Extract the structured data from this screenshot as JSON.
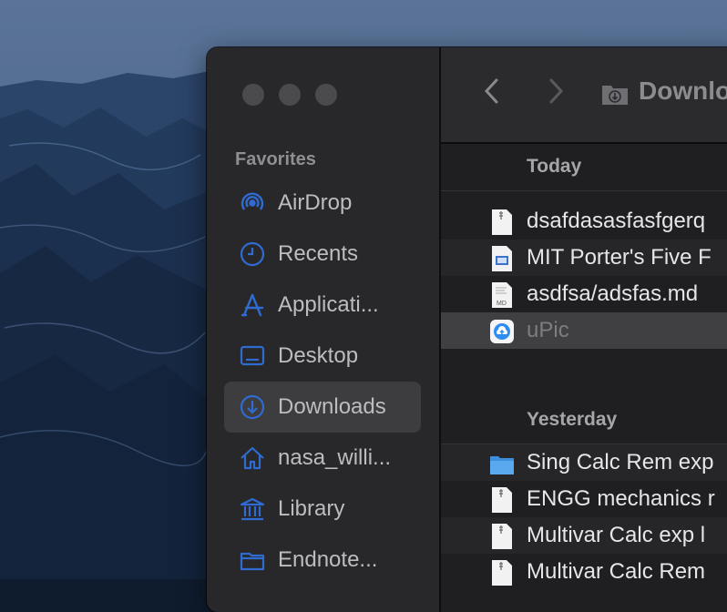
{
  "sidebar": {
    "heading": "Favorites",
    "items": [
      {
        "label": "AirDrop",
        "icon": "airdrop-icon"
      },
      {
        "label": "Recents",
        "icon": "clock-icon"
      },
      {
        "label": "Applicati...",
        "icon": "applications-icon"
      },
      {
        "label": "Desktop",
        "icon": "desktop-icon"
      },
      {
        "label": "Downloads",
        "icon": "download-icon",
        "selected": true
      },
      {
        "label": "nasa_willi...",
        "icon": "home-icon"
      },
      {
        "label": "Library",
        "icon": "library-icon"
      },
      {
        "label": "Endnote...",
        "icon": "folder-icon"
      }
    ]
  },
  "toolbar": {
    "title": "Downlo",
    "back_icon": "chevron-left-icon",
    "forward_icon": "chevron-right-icon"
  },
  "groups": [
    {
      "label": "Today",
      "files": [
        {
          "name": "dsafdasasfasfgerq",
          "icon": "document-icon"
        },
        {
          "name": "MIT Porter's Five F",
          "icon": "presentation-file-icon"
        },
        {
          "name": "asdfsa/adsfas.md",
          "icon": "markdown-file-icon"
        },
        {
          "name": "uPic",
          "icon": "upic-app-icon"
        }
      ]
    },
    {
      "label": "Yesterday",
      "files": [
        {
          "name": "Sing Calc Rem exp",
          "icon": "folder-icon"
        },
        {
          "name": "ENGG mechanics r",
          "icon": "document-icon"
        },
        {
          "name": "Multivar Calc exp l",
          "icon": "document-icon"
        },
        {
          "name": "Multivar Calc Rem",
          "icon": "document-icon"
        }
      ]
    }
  ],
  "colors": {
    "accent": "#2f6bd0",
    "sidebar_bg": "#28282b",
    "window_bg": "#1f1f21"
  }
}
